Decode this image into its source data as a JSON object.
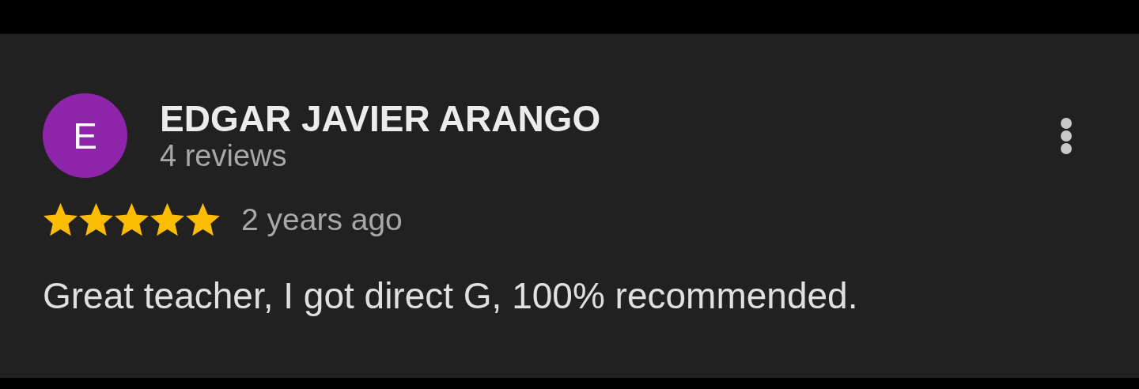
{
  "review": {
    "avatar": {
      "letter": "E",
      "color": "#8e24aa"
    },
    "author": "EDGAR JAVIER ARANGO",
    "review_count": "4 reviews",
    "stars": 5,
    "time": "2 years ago",
    "text": "Great teacher, I got direct G, 100% recommended."
  }
}
